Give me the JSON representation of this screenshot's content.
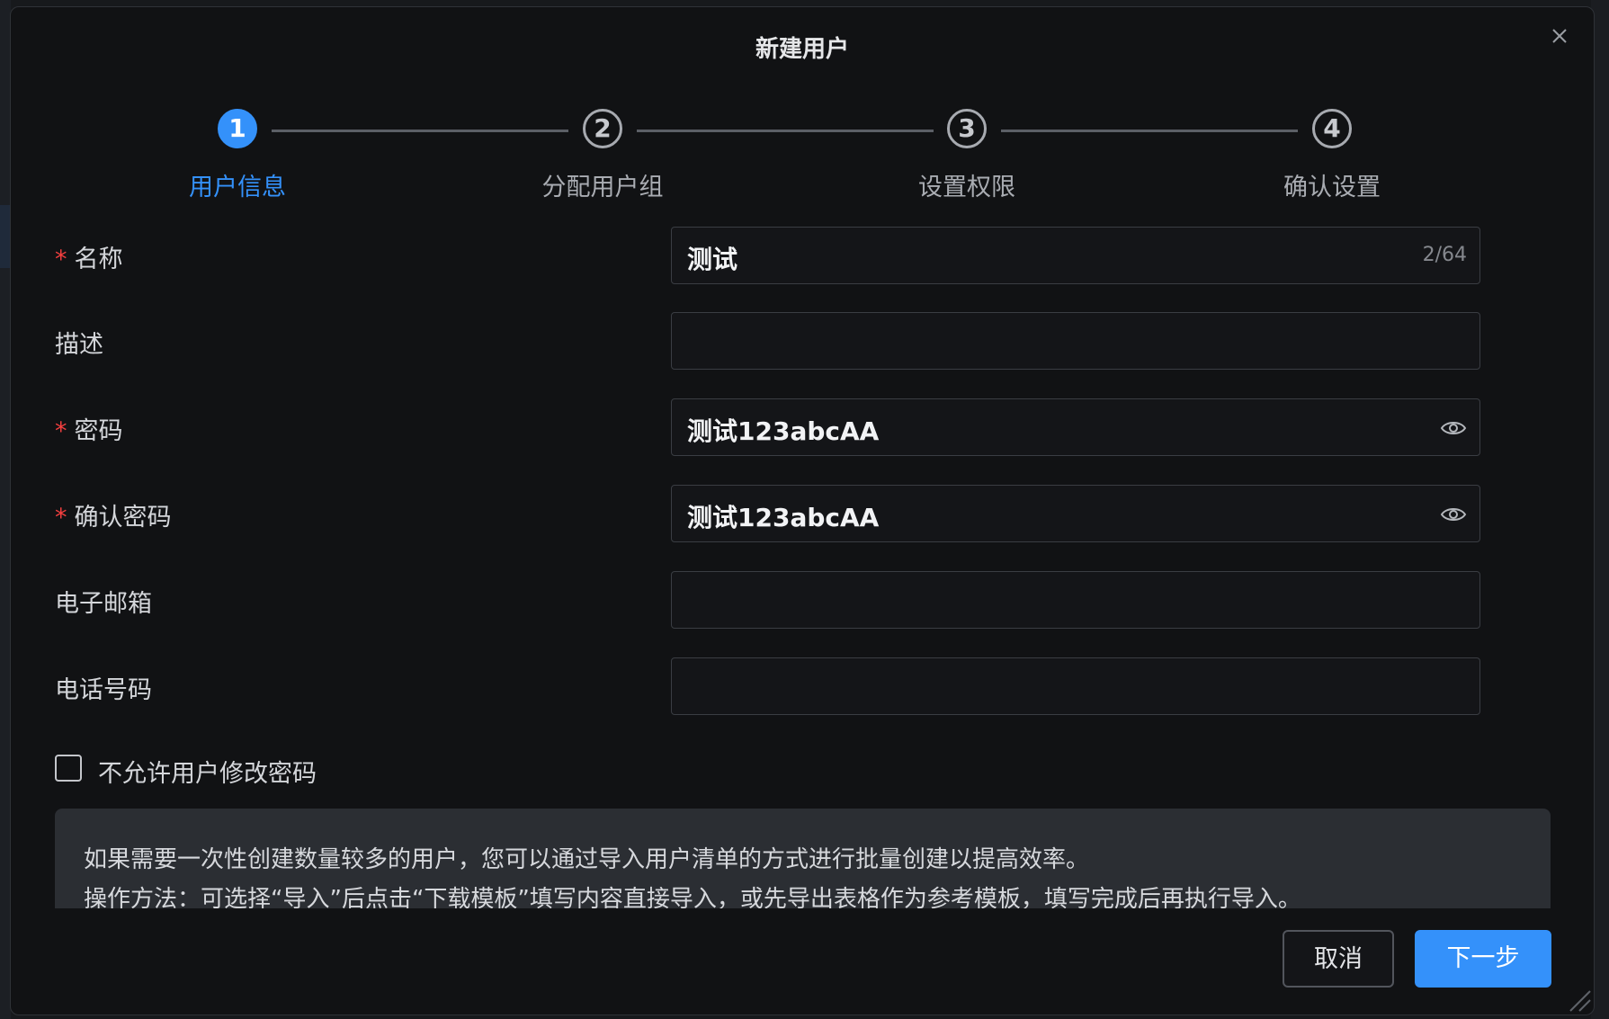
{
  "dialog": {
    "title": "新建用户"
  },
  "steps": [
    {
      "number": "1",
      "label": "用户信息",
      "active": true
    },
    {
      "number": "2",
      "label": "分配用户组",
      "active": false
    },
    {
      "number": "3",
      "label": "设置权限",
      "active": false
    },
    {
      "number": "4",
      "label": "确认设置",
      "active": false
    }
  ],
  "form": {
    "name": {
      "label": "名称",
      "required_mark": "*",
      "value": "测试",
      "count": "2/64"
    },
    "description": {
      "label": "描述",
      "value": ""
    },
    "password": {
      "label": "密码",
      "required_mark": "*",
      "value": "测试123abcAA",
      "icon": "eye-icon"
    },
    "confirm_password": {
      "label": "确认密码",
      "required_mark": "*",
      "value": "测试123abcAA",
      "icon": "eye-icon"
    },
    "email": {
      "label": "电子邮箱",
      "value": ""
    },
    "phone": {
      "label": "电话号码",
      "value": ""
    },
    "no_change_password": {
      "label": "不允许用户修改密码",
      "checked": false
    }
  },
  "tip": {
    "line1": "如果需要一次性创建数量较多的用户，您可以通过导入用户清单的方式进行批量创建以提高效率。",
    "line2": "操作方法：可选择“导入”后点击“下载模板”填写内容直接导入，或先导出表格作为参考模板，填写完成后再执行导入。"
  },
  "buttons": {
    "cancel": "取消",
    "next": "下一步"
  },
  "colors": {
    "accent": "#3491fa",
    "required": "#f53f3f",
    "dialog_bg": "#111214"
  }
}
